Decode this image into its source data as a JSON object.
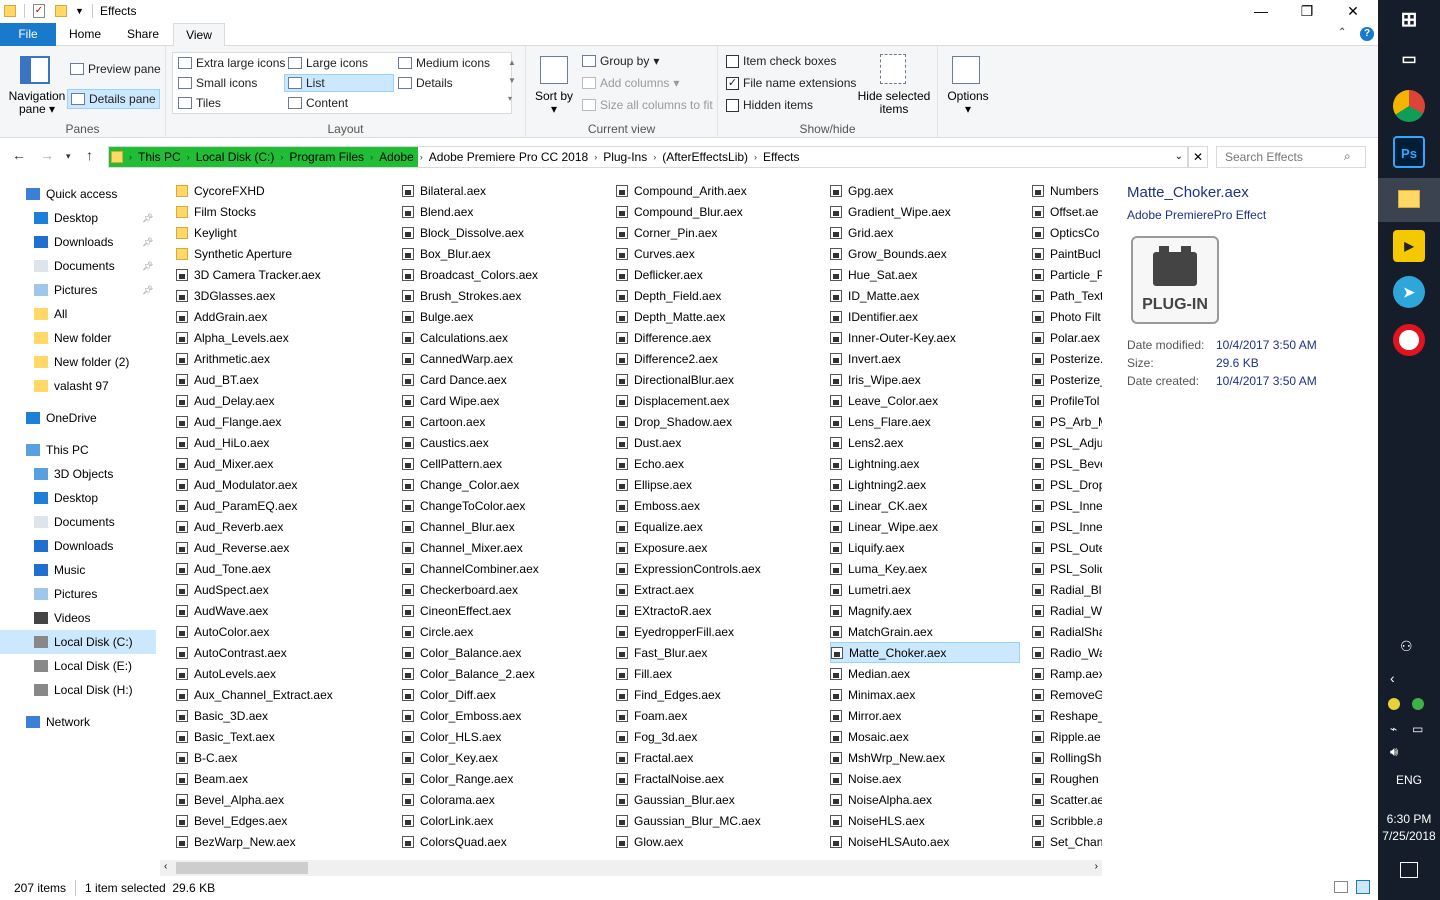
{
  "window": {
    "title": "Effects",
    "minimize": "—",
    "maximize": "❐",
    "close": "✕"
  },
  "tabs": {
    "file": "File",
    "home": "Home",
    "share": "Share",
    "view": "View"
  },
  "ribbon": {
    "panes": {
      "label": "Panes",
      "nav_pane": "Navigation pane",
      "preview_pane": "Preview pane",
      "details_pane": "Details pane"
    },
    "layout": {
      "label": "Layout",
      "xl_icons": "Extra large icons",
      "large_icons": "Large icons",
      "medium_icons": "Medium icons",
      "small_icons": "Small icons",
      "list": "List",
      "details": "Details",
      "tiles": "Tiles",
      "content": "Content"
    },
    "current_view": {
      "label": "Current view",
      "sort_by": "Sort by",
      "group_by": "Group by",
      "add_columns": "Add columns",
      "size_cols": "Size all columns to fit"
    },
    "show_hide": {
      "label": "Show/hide",
      "item_check": "Item check boxes",
      "file_ext": "File name extensions",
      "hidden": "Hidden items",
      "hide_selected": "Hide selected items"
    },
    "options": "Options"
  },
  "address": {
    "crumbs": [
      "This PC",
      "Local Disk (C:)",
      "Program Files",
      "Adobe",
      "Adobe Premiere Pro CC 2018",
      "Plug-Ins",
      "(AfterEffectsLib)",
      "Effects"
    ],
    "search_placeholder": "Search Effects"
  },
  "nav": [
    {
      "label": "Quick access",
      "icon": "star-icon",
      "level": 0
    },
    {
      "label": "Desktop",
      "icon": "desktop-icon",
      "level": 1,
      "pinned": true
    },
    {
      "label": "Downloads",
      "icon": "download-icon",
      "level": 1,
      "pinned": true
    },
    {
      "label": "Documents",
      "icon": "document-icon",
      "level": 1,
      "pinned": true
    },
    {
      "label": "Pictures",
      "icon": "pictures-icon",
      "level": 1,
      "pinned": true
    },
    {
      "label": "All",
      "icon": "folder-icon",
      "level": 1
    },
    {
      "label": "New folder",
      "icon": "folder-icon",
      "level": 1
    },
    {
      "label": "New folder (2)",
      "icon": "folder-icon",
      "level": 1
    },
    {
      "label": "valasht 97",
      "icon": "folder-icon",
      "level": 1
    },
    {
      "label": "OneDrive",
      "icon": "cloud-icon",
      "level": 0,
      "gap": true
    },
    {
      "label": "This PC",
      "icon": "computer-icon",
      "level": 0,
      "gap": true
    },
    {
      "label": "3D Objects",
      "icon": "cube-icon",
      "level": 1
    },
    {
      "label": "Desktop",
      "icon": "desktop-icon",
      "level": 1
    },
    {
      "label": "Documents",
      "icon": "document-icon",
      "level": 1
    },
    {
      "label": "Downloads",
      "icon": "download-icon",
      "level": 1
    },
    {
      "label": "Music",
      "icon": "music-icon",
      "level": 1
    },
    {
      "label": "Pictures",
      "icon": "pictures-icon",
      "level": 1
    },
    {
      "label": "Videos",
      "icon": "video-icon",
      "level": 1
    },
    {
      "label": "Local Disk (C:)",
      "icon": "drive-icon",
      "level": 1,
      "selected": true
    },
    {
      "label": "Local Disk (E:)",
      "icon": "drive-icon",
      "level": 1
    },
    {
      "label": "Local Disk (H:)",
      "icon": "drive-icon",
      "level": 1
    },
    {
      "label": "Network",
      "icon": "network-icon",
      "level": 0,
      "gap": true
    }
  ],
  "files": [
    [
      "CycoreFXHD",
      "Film Stocks",
      "Keylight",
      "Synthetic Aperture",
      "3D Camera Tracker.aex",
      "3DGlasses.aex",
      "AddGrain.aex",
      "Alpha_Levels.aex",
      "Arithmetic.aex",
      "Aud_BT.aex",
      "Aud_Delay.aex",
      "Aud_Flange.aex",
      "Aud_HiLo.aex",
      "Aud_Mixer.aex",
      "Aud_Modulator.aex",
      "Aud_ParamEQ.aex",
      "Aud_Reverb.aex",
      "Aud_Reverse.aex",
      "Aud_Tone.aex",
      "AudSpect.aex",
      "AudWave.aex",
      "AutoColor.aex",
      "AutoContrast.aex",
      "AutoLevels.aex",
      "Aux_Channel_Extract.aex",
      "Basic_3D.aex",
      "Basic_Text.aex",
      "B-C.aex",
      "Beam.aex",
      "Bevel_Alpha.aex",
      "Bevel_Edges.aex",
      "BezWarp_New.aex"
    ],
    [
      "Bilateral.aex",
      "Blend.aex",
      "Block_Dissolve.aex",
      "Box_Blur.aex",
      "Broadcast_Colors.aex",
      "Brush_Strokes.aex",
      "Bulge.aex",
      "Calculations.aex",
      "CannedWarp.aex",
      "Card Dance.aex",
      "Card Wipe.aex",
      "Cartoon.aex",
      "Caustics.aex",
      "CellPattern.aex",
      "Change_Color.aex",
      "ChangeToColor.aex",
      "Channel_Blur.aex",
      "Channel_Mixer.aex",
      "ChannelCombiner.aex",
      "Checkerboard.aex",
      "CineonEffect.aex",
      "Circle.aex",
      "Color_Balance.aex",
      "Color_Balance_2.aex",
      "Color_Diff.aex",
      "Color_Emboss.aex",
      "Color_HLS.aex",
      "Color_Key.aex",
      "Color_Range.aex",
      "Colorama.aex",
      "ColorLink.aex",
      "ColorsQuad.aex"
    ],
    [
      "Compound_Arith.aex",
      "Compound_Blur.aex",
      "Corner_Pin.aex",
      "Curves.aex",
      "Deflicker.aex",
      "Depth_Field.aex",
      "Depth_Matte.aex",
      "Difference.aex",
      "Difference2.aex",
      "DirectionalBlur.aex",
      "Displacement.aex",
      "Drop_Shadow.aex",
      "Dust.aex",
      "Echo.aex",
      "Ellipse.aex",
      "Emboss.aex",
      "Equalize.aex",
      "Exposure.aex",
      "ExpressionControls.aex",
      "Extract.aex",
      "EXtractoR.aex",
      "EyedropperFill.aex",
      "Fast_Blur.aex",
      "Fill.aex",
      "Find_Edges.aex",
      "Foam.aex",
      "Fog_3d.aex",
      "Fractal.aex",
      "FractalNoise.aex",
      "Gaussian_Blur.aex",
      "Gaussian_Blur_MC.aex",
      "Glow.aex"
    ],
    [
      "Gpg.aex",
      "Gradient_Wipe.aex",
      "Grid.aex",
      "Grow_Bounds.aex",
      "Hue_Sat.aex",
      "ID_Matte.aex",
      "IDentifier.aex",
      "Inner-Outer-Key.aex",
      "Invert.aex",
      "Iris_Wipe.aex",
      "Leave_Color.aex",
      "Lens_Flare.aex",
      "Lens2.aex",
      "Lightning.aex",
      "Lightning2.aex",
      "Linear_CK.aex",
      "Linear_Wipe.aex",
      "Liquify.aex",
      "Luma_Key.aex",
      "Lumetri.aex",
      "Magnify.aex",
      "MatchGrain.aex",
      "Matte_Choker.aex",
      "Median.aex",
      "Minimax.aex",
      "Mirror.aex",
      "Mosaic.aex",
      "MshWrp_New.aex",
      "Noise.aex",
      "NoiseAlpha.aex",
      "NoiseHLS.aex",
      "NoiseHLSAuto.aex"
    ],
    [
      "Numbers",
      "Offset.ae",
      "OpticsCo",
      "PaintBucl",
      "Particle_P",
      "Path_Text",
      "Photo Filt",
      "Polar.aex",
      "Posterize.",
      "Posterize_",
      "ProfileTol",
      "PS_Arb_M",
      "PSL_Adju",
      "PSL_Beve",
      "PSL_Drop",
      "PSL_Inner",
      "PSL_Inner",
      "PSL_Oute",
      "PSL_Solid",
      "Radial_Bl",
      "Radial_W",
      "RadialSha",
      "Radio_Wa",
      "Ramp.aex",
      "RemoveG",
      "Reshape_",
      "Ripple.ae",
      "RollingSh",
      "Roughen",
      "Scatter.ae",
      "Scribble.a",
      "Set_Chan"
    ]
  ],
  "details_pane": {
    "name": "Matte_Choker.aex",
    "type": "Adobe PremierePro Effect",
    "badge": "PLUG-IN",
    "date_modified_label": "Date modified:",
    "date_modified": "10/4/2017 3:50 AM",
    "size_label": "Size:",
    "size": "29.6 KB",
    "date_created_label": "Date created:",
    "date_created": "10/4/2017 3:50 AM"
  },
  "status": {
    "items": "207 items",
    "selected": "1 item selected  29.6 KB"
  },
  "taskbar": {
    "lang": "ENG",
    "time": "6:30 PM",
    "date": "7/25/2018"
  },
  "colors": {
    "accent": "#1979ca",
    "selection": "#cce8ff",
    "address_highlight": "#1fbe35",
    "taskbar": "#151d2a"
  }
}
